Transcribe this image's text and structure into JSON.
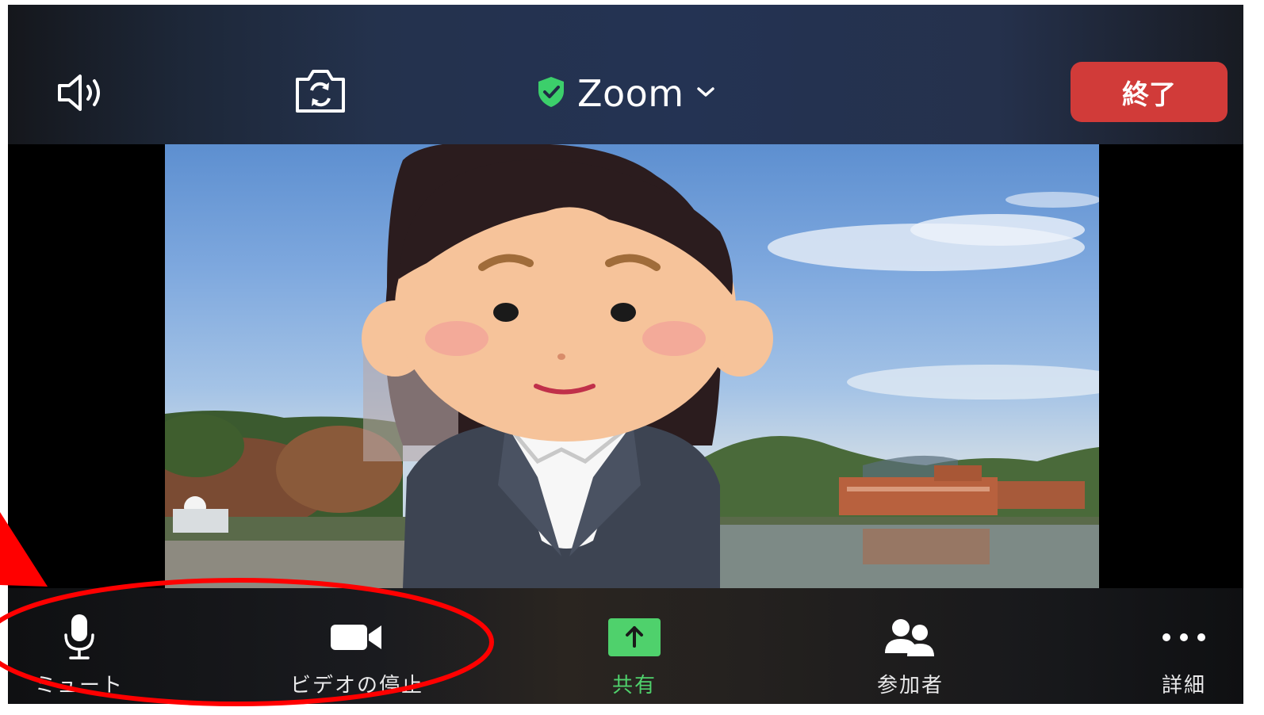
{
  "header": {
    "title": "Zoom",
    "end_label": "終了",
    "icons": {
      "speaker": "speaker-icon",
      "camera_flip": "camera-flip-icon",
      "secure": "shield-check-icon",
      "title_menu": "chevron-down-icon"
    }
  },
  "toolbar": {
    "items": [
      {
        "label": "ミュート",
        "icon": "microphone-icon"
      },
      {
        "label": "ビデオの停止",
        "icon": "video-camera-icon"
      },
      {
        "label": "共有",
        "icon": "share-arrow-up-icon"
      },
      {
        "label": "参加者",
        "icon": "participants-icon"
      },
      {
        "label": "詳細",
        "icon": "more-dots-icon"
      }
    ]
  },
  "colors": {
    "end_button": "#d13b39",
    "share_accent": "#4fd16c",
    "secure_badge": "#3ccf6b",
    "annotation": "#ff0000"
  }
}
